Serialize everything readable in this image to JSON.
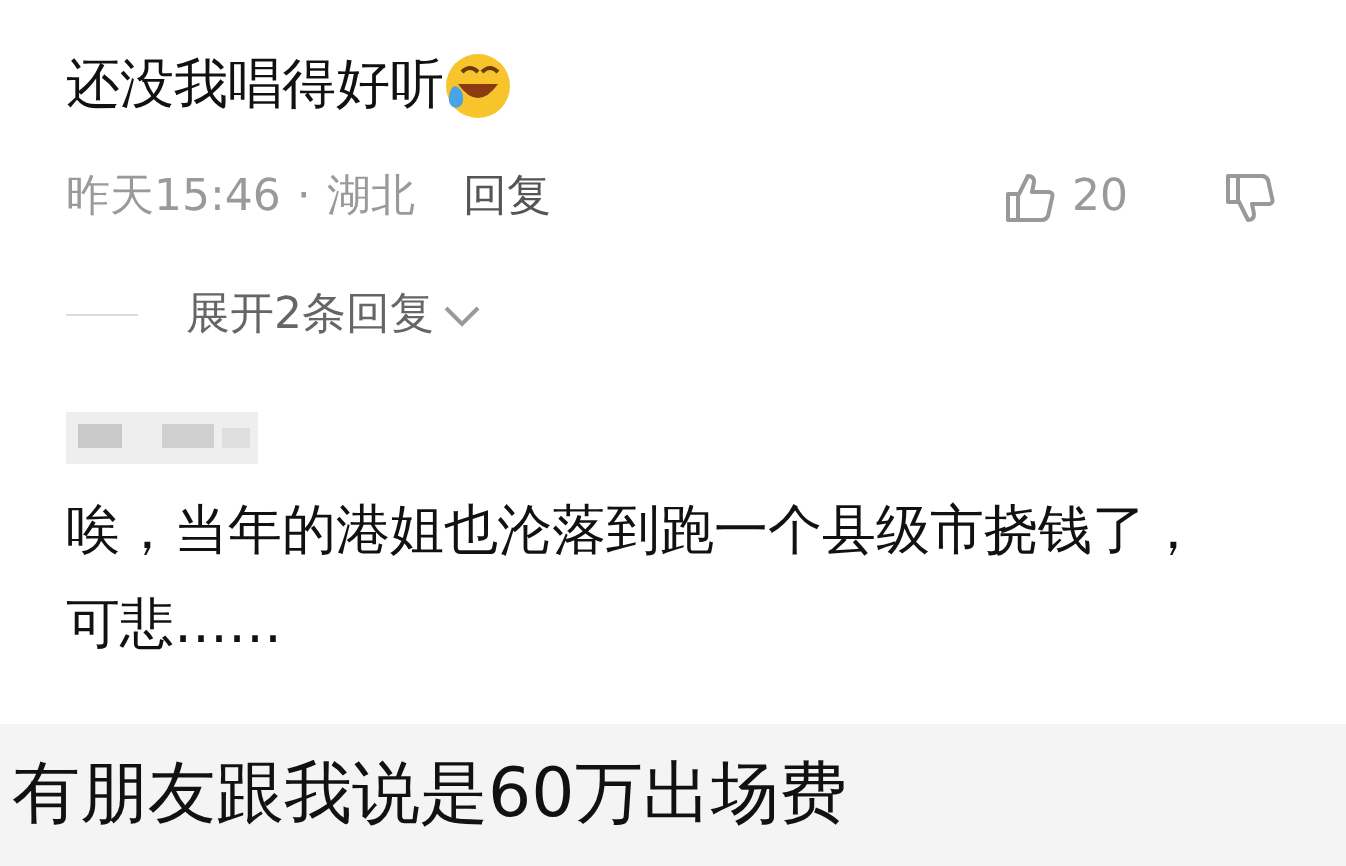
{
  "comments": [
    {
      "text": "还没我唱得好听",
      "time": "昨天15:46",
      "separator": "·",
      "region": "湖北",
      "reply": "回复",
      "likes": "20",
      "expand": "展开2条回复"
    },
    {
      "username_blurred": true,
      "text": "唉，当年的港姐也沦落到跑一个县级市挠钱了，可悲……"
    }
  ],
  "caption": "有朋友跟我说是60万出场费"
}
